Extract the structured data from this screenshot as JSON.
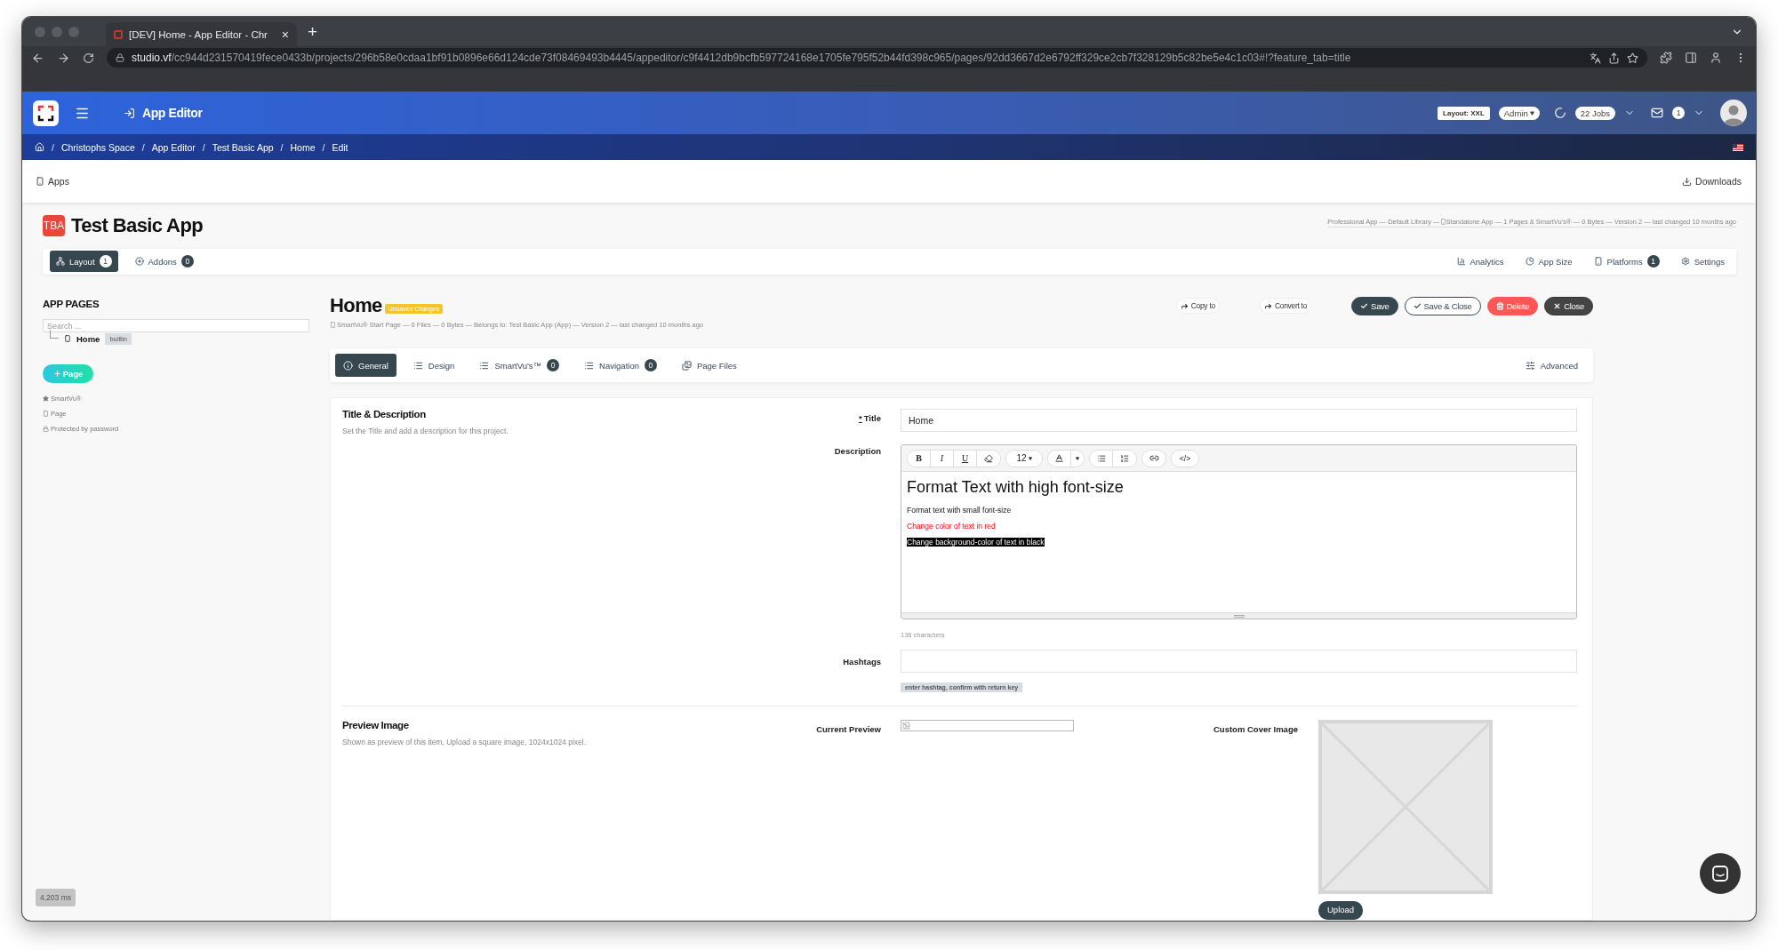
{
  "browser": {
    "tab_title": "[DEV] Home - App Editor - Chr",
    "tab_close": "×",
    "new_tab": "+",
    "url_host": "studio.vf",
    "url_path": "/cc944d231570419fece0433b/projects/296b58e0cdaa1bf91b0896e66d124cde73f08469493b4445/appeditor/c9f4412db9bcfb597724168e1705fe795f52b44fd398c965/pages/92dd3667d2e6792ff329ce2cb7f328129b5c82be5e4c1c03#!?feature_tab=title"
  },
  "header": {
    "title": "App Editor",
    "layout_badge": "Layout: XXL",
    "role": "Admin",
    "jobs": "22 Jobs",
    "messages_count": "1"
  },
  "breadcrumbs": [
    "Christophs Space",
    "App Editor",
    "Test Basic App",
    "Home",
    "Edit"
  ],
  "breadcrumb_separators": [
    "/",
    "/",
    "/",
    "/",
    "/"
  ],
  "top_bar": {
    "apps": "Apps",
    "downloads": "Downloads"
  },
  "app": {
    "initials": "TBA",
    "name": "Test Basic App",
    "meta_before": "Professional App — Default Library — ",
    "meta_after": "Standalone App — 1 Pages & SmartVu's® — 0 Bytes — Version 2 — last changed 10 months ago"
  },
  "app_nav": {
    "left": [
      {
        "label": "Layout",
        "count": "1",
        "selected": true
      },
      {
        "label": "Addons",
        "count": "0",
        "selected": false
      }
    ],
    "right": [
      {
        "label": "Analytics"
      },
      {
        "label": "App Size"
      },
      {
        "label": "Platforms",
        "count": "1"
      },
      {
        "label": "Settings"
      }
    ]
  },
  "sidebar": {
    "heading": "APP PAGES",
    "search_placeholder": "Search ...",
    "pages": [
      {
        "label": "Home",
        "badge": "builtin"
      }
    ],
    "add_button": "Page",
    "legend": [
      "SmartVu®",
      "Page",
      "Protected by password"
    ]
  },
  "page": {
    "title": "Home",
    "status_badge": "Unsaved Changes",
    "meta": "SmartVu® Start Page — 0 Files — 0 Bytes — Belongs to: Test Basic App (App) — Version 2 — last changed 10 months ago",
    "actions": [
      {
        "label": "Copy to",
        "kind": "link"
      },
      {
        "label": "Convert to",
        "kind": "link"
      },
      {
        "label": "Save",
        "kind": "primary"
      },
      {
        "label": "Save & Close",
        "kind": "outline"
      },
      {
        "label": "Delete",
        "kind": "danger"
      },
      {
        "label": "Close",
        "kind": "dark"
      }
    ]
  },
  "tabs": [
    {
      "label": "General",
      "selected": true
    },
    {
      "label": "Design",
      "selected": false
    },
    {
      "label": "SmartVu's™",
      "count": "0",
      "selected": false
    },
    {
      "label": "Navigation",
      "count": "0",
      "selected": false
    },
    {
      "label": "Page Files",
      "selected": false
    }
  ],
  "advanced": "Advanced",
  "title_section": {
    "heading": "Title & Description",
    "hint": "Set the Title and add a description for this project.",
    "required_mark": "*",
    "title_label": "Title",
    "title_value": "Home",
    "description_label": "Description",
    "toolbar": {
      "bold": "B",
      "italic": "I",
      "underline": "U",
      "font_size": "12",
      "code": "</>"
    },
    "description_lines": [
      {
        "kind": "heading",
        "text": "Format Text with high font-size"
      },
      {
        "kind": "small",
        "text": "Format text with small font-size"
      },
      {
        "kind": "red",
        "text": "Change color of text in red"
      },
      {
        "kind": "highlight",
        "text": "Change background-color of text in black"
      }
    ],
    "char_count": "136 characters",
    "hashtags_label": "Hashtags",
    "hashtags_hint": "enter hashtag, confirm with return key"
  },
  "preview_section": {
    "heading": "Preview Image",
    "hint": "Shown as preview of this item. Upload a square image, 1024x1024 pixel.",
    "current_label": "Current Preview",
    "cover_label": "Custom Cover Image",
    "upload_button": "Upload"
  },
  "timing": "4.203 ms"
}
